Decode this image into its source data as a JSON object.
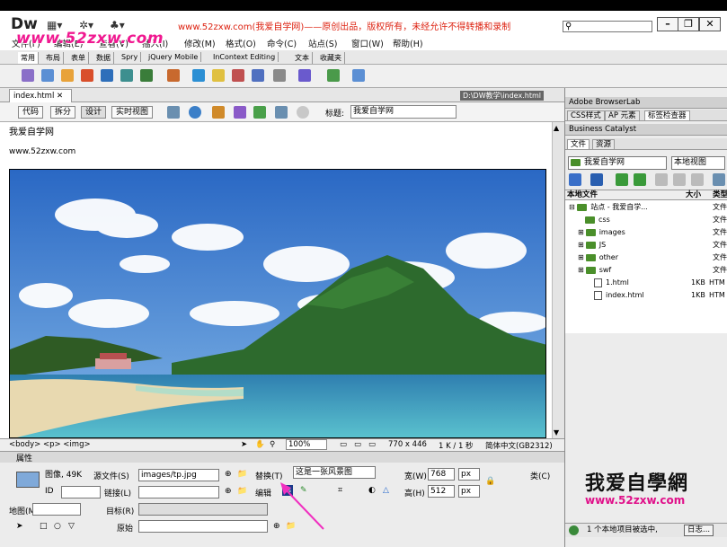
{
  "app": {
    "name": "Dw"
  },
  "notice": "www.52zxw.com(我爱自学网)——原创出品，版权所有，未经允许不得转播和录制",
  "watermark": "www.52zxw.com",
  "menu": [
    "文件(F)",
    "编辑(E)",
    "查看(V)",
    "插入(I)",
    "修改(M)",
    "格式(O)",
    "命令(C)",
    "站点(S)",
    "窗口(W)",
    "帮助(H)"
  ],
  "insert_tabs": [
    "常用",
    "布局",
    "表单",
    "数据",
    "Spry",
    "jQuery Mobile",
    "InContext Editing",
    "文本",
    "收藏夹"
  ],
  "document": {
    "tab": "index.html",
    "path": "D:\\DW教学\\index.html",
    "view_buttons": [
      "代码",
      "拆分",
      "设计",
      "实时视图"
    ],
    "title_label": "标题:",
    "title_value": "我爱自学网",
    "content_line1": "我爱自学网",
    "content_line2": "www.52zxw.com"
  },
  "statusbar": {
    "tag_path": "<body> <p> <img>",
    "zoom": "100%",
    "size": "770 x 446",
    "weight": "1 K / 1 秒",
    "encoding": "简体中文(GB2312)"
  },
  "properties": {
    "header": "属性",
    "image_label": "图像, 49K",
    "src_label": "源文件(S)",
    "src_value": "images/tp.jpg",
    "alt_label": "替换(T)",
    "alt_value": "这是一张风景图",
    "id_label": "ID",
    "link_label": "链接(L)",
    "edit_label": "编辑",
    "width_label": "宽(W)",
    "width_value": "768",
    "height_label": "高(H)",
    "height_value": "512",
    "unit": "px",
    "class_label": "类(C)",
    "map_label": "地图(M)",
    "target_label": "目标(R)",
    "original_label": "原始"
  },
  "panels": {
    "browserlab": "Adobe BrowserLab",
    "css_tabs": [
      "CSS样式",
      "AP 元素",
      "标签检查器"
    ],
    "business": "Business Catalyst",
    "file_tabs": [
      "文件",
      "资源"
    ],
    "site_select": "我爱自学网",
    "view_select": "本地视图",
    "columns": [
      "本地文件",
      "大小",
      "类型"
    ],
    "site_root": "站点 - 我爱自学...",
    "files": [
      {
        "name": "css",
        "type": "文件"
      },
      {
        "name": "images",
        "type": "文件"
      },
      {
        "name": "JS",
        "type": "文件"
      },
      {
        "name": "other",
        "type": "文件"
      },
      {
        "name": "swf",
        "type": "文件"
      },
      {
        "name": "1.html",
        "size": "1KB",
        "type": "HTM"
      },
      {
        "name": "index.html",
        "size": "1KB",
        "type": "HTM"
      }
    ],
    "root_type": "文件",
    "brand": "我爱自學網",
    "brand_url": "www.52zxw.com",
    "status": "1 个本地项目被选中,",
    "log_button": "日志..."
  }
}
